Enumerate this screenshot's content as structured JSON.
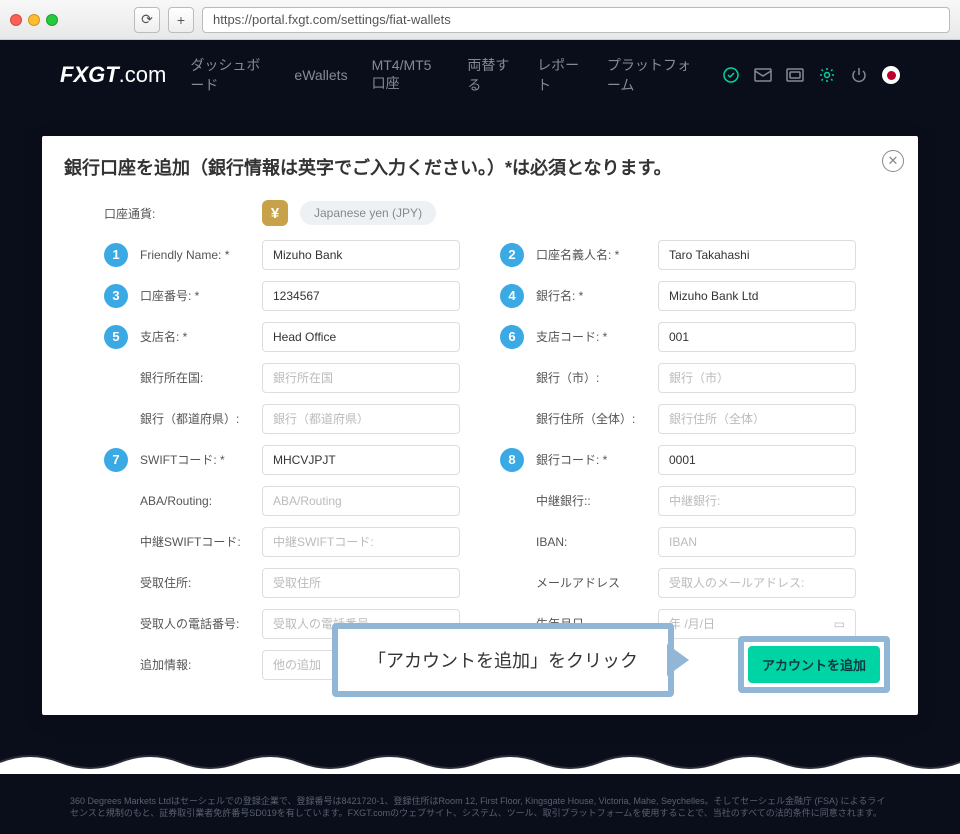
{
  "browser": {
    "url": "https://portal.fxgt.com/settings/fiat-wallets"
  },
  "header": {
    "logo_main": "FXGT",
    "logo_suffix": ".com",
    "nav": [
      "ダッシュボード",
      "eWallets",
      "MT4/MT5口座",
      "両替する",
      "レポート",
      "プラットフォーム"
    ]
  },
  "modal": {
    "title": "銀行口座を追加（銀行情報は英字でご入力ください。）*は必須となります。",
    "currency_label": "口座通貨:",
    "currency_value": "Japanese yen (JPY)",
    "left_fields": [
      {
        "num": "1",
        "label": "Friendly Name: *",
        "value": "Mizuho Bank"
      },
      {
        "num": "3",
        "label": "口座番号: *",
        "value": "1234567"
      },
      {
        "num": "5",
        "label": "支店名: *",
        "value": "Head Office"
      },
      {
        "num": "",
        "label": "銀行所在国:",
        "placeholder": "銀行所在国"
      },
      {
        "num": "",
        "label": "銀行（都道府県）:",
        "placeholder": "銀行（都道府県）"
      },
      {
        "num": "7",
        "label": "SWIFTコード: *",
        "value": "MHCVJPJT"
      },
      {
        "num": "",
        "label": "ABA/Routing:",
        "placeholder": "ABA/Routing"
      },
      {
        "num": "",
        "label": "中継SWIFTコード:",
        "placeholder": "中継SWIFTコード:"
      },
      {
        "num": "",
        "label": "受取住所:",
        "placeholder": "受取住所"
      },
      {
        "num": "",
        "label": "受取人の電話番号:",
        "placeholder": "受取人の電話番号"
      },
      {
        "num": "",
        "label": "追加情報:",
        "placeholder": "他の追加"
      }
    ],
    "right_fields": [
      {
        "num": "2",
        "label": "口座名義人名: *",
        "value": "Taro Takahashi"
      },
      {
        "num": "4",
        "label": "銀行名: *",
        "value": "Mizuho Bank Ltd"
      },
      {
        "num": "6",
        "label": "支店コード: *",
        "value": "001"
      },
      {
        "num": "",
        "label": "銀行（市）:",
        "placeholder": "銀行（市）"
      },
      {
        "num": "",
        "label": "銀行住所（全体）:",
        "placeholder": "銀行住所（全体）"
      },
      {
        "num": "8",
        "label": "銀行コード: *",
        "value": "0001"
      },
      {
        "num": "",
        "label": "中継銀行::",
        "placeholder": "中継銀行:"
      },
      {
        "num": "",
        "label": "IBAN:",
        "placeholder": "IBAN"
      },
      {
        "num": "",
        "label": "メールアドレス",
        "placeholder": "受取人のメールアドレス:"
      },
      {
        "num": "",
        "label": "生年月日",
        "placeholder": "年 /月/日",
        "is_date": true
      }
    ],
    "callout": "「アカウントを追加」をクリック",
    "add_button": "アカウントを追加"
  },
  "footer": {
    "text": "360 Degrees Markets Ltdはセーシェルでの登録企業で、登録番号は8421720-1、登録住所はRoom 12, First Floor, Kingsgate House, Victoria, Mahe, Seychelles。そしてセーシェル金融庁 (FSA) によるライセンスと規制のもと、証券取引業者免許番号SD019を有しています。FXGT.comのウェブサイト、システム、ツール、取引プラットフォームを使用することで、当社のすべての法的条件に同意されます。"
  }
}
